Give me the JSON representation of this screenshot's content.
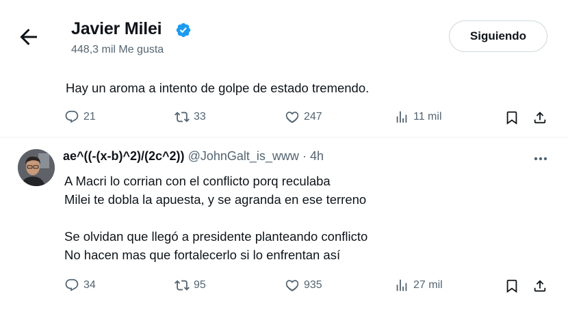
{
  "header": {
    "name": "Javier Milei",
    "likes": "448,3 mil Me gusta",
    "follow_label": "Siguiendo"
  },
  "main_tweet": {
    "text": "Hay un aroma a intento de golpe de estado tremendo.",
    "replies": "21",
    "retweets": "33",
    "likes": "247",
    "views": "11 mil"
  },
  "reply": {
    "name": "ae^((-(x-b)^2)/(2c^2))",
    "handle": "@JohnGalt_is_www",
    "separator": "·",
    "time": "4h",
    "lines": [
      "A Macri lo corrian con el conflicto porq reculaba",
      "Milei te dobla la apuesta, y se agranda en ese terreno",
      "",
      "Se olvidan que llegó a presidente planteando conflicto",
      "No hacen mas que fortalecerlo si lo enfrentan así"
    ],
    "replies": "34",
    "retweets": "95",
    "likes": "935",
    "views": "27 mil"
  },
  "colors": {
    "verified_blue": "#1d9bf0",
    "text_primary": "#0f1419",
    "text_secondary": "#536471",
    "border": "#cfd9de"
  },
  "icons": [
    "back-arrow-icon",
    "verified-badge-icon",
    "reply-icon",
    "retweet-icon",
    "like-icon",
    "views-icon",
    "bookmark-icon",
    "share-icon",
    "more-icon"
  ]
}
